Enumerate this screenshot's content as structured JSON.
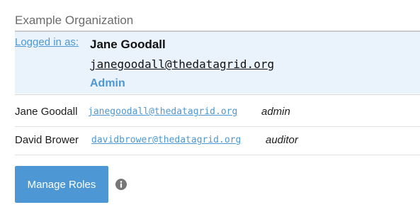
{
  "org": {
    "title": "Example Organization"
  },
  "current_user": {
    "logged_in_label": "Logged in as:",
    "name": "Jane Goodall",
    "email": "janegoodall@thedatagrid.org",
    "role": "Admin"
  },
  "members": [
    {
      "name": "Jane Goodall",
      "email": "janegoodall@thedatagrid.org",
      "role": "admin"
    },
    {
      "name": "David Brower",
      "email": "davidbrower@thedatagrid.org",
      "role": "auditor"
    }
  ],
  "actions": {
    "manage_roles_label": "Manage Roles",
    "info_icon": "info-circle-icon"
  },
  "colors": {
    "accent": "#4d98d4",
    "highlight_bg": "#eaf3fb",
    "info_icon": "#777777"
  }
}
